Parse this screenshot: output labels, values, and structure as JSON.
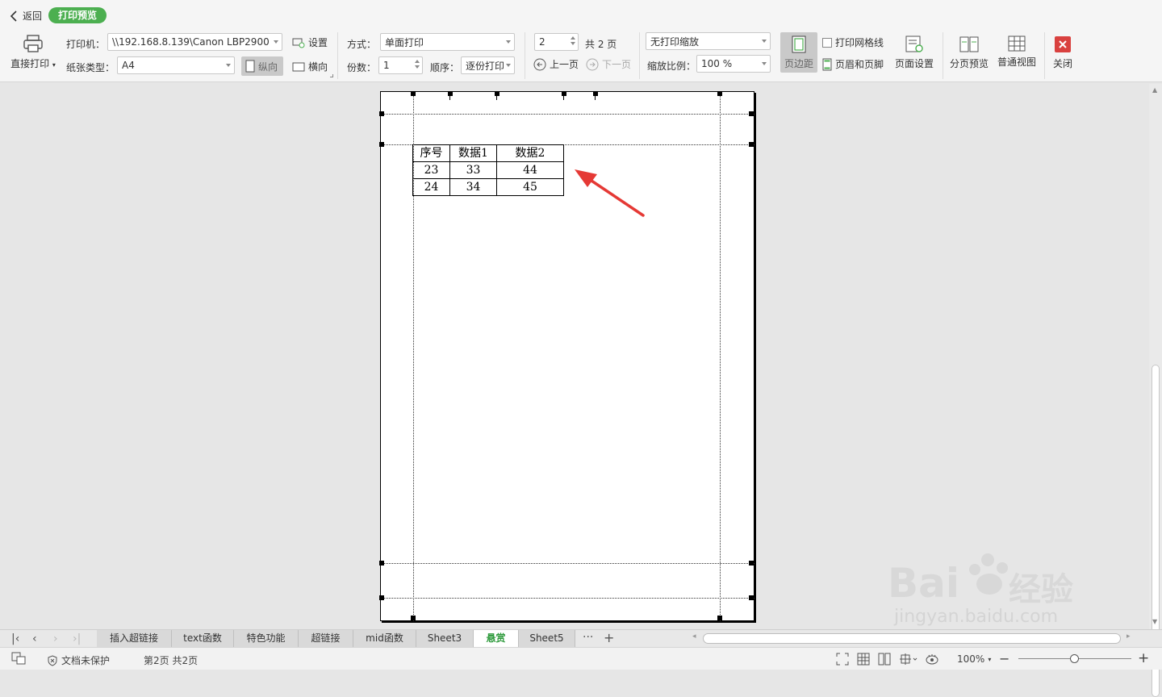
{
  "header": {
    "back_label": "返回",
    "mode_badge": "打印预览"
  },
  "print": {
    "direct_print_label": "直接打印",
    "printer_label": "打印机：",
    "printer_value": "\\\\192.168.8.139\\Canon LBP2900",
    "paper_label": "纸张类型：",
    "paper_value": "A4",
    "settings_label": "设置",
    "portrait_label": "纵向",
    "landscape_label": "横向",
    "method_label": "方式：",
    "method_value": "单面打印",
    "copies_label": "份数：",
    "copies_value": "1",
    "order_label": "顺序：",
    "order_value": "逐份打印",
    "page_value": "2",
    "page_total": "共 2 页",
    "prev_label": "上一页",
    "next_label": "下一页",
    "scale_mode_value": "无打印缩放",
    "scale_ratio_label": "缩放比例：",
    "scale_ratio_value": "100 %",
    "margins_label": "页边距",
    "gridlines_label": "打印网格线",
    "header_footer_label": "页眉和页脚",
    "page_setup_label": "页面设置",
    "page_break_label": "分页预览",
    "normal_view_label": "普通视图",
    "close_label": "关闭"
  },
  "sheet": {
    "headers": [
      "序号",
      "数据1",
      "数据2"
    ],
    "rows": [
      [
        "23",
        "33",
        "44"
      ],
      [
        "24",
        "34",
        "45"
      ]
    ]
  },
  "tabs": [
    {
      "label": "插入超链接"
    },
    {
      "label": "text函数"
    },
    {
      "label": "特色功能"
    },
    {
      "label": "超链接"
    },
    {
      "label": "mid函数"
    },
    {
      "label": "Sheet3"
    },
    {
      "label": "悬赏",
      "active": true
    },
    {
      "label": "Sheet5"
    }
  ],
  "tabs_more": "···",
  "tabs_add": "+",
  "status": {
    "protect_label": "文档未保护",
    "page_info": "第2页 共2页",
    "zoom_value": "100%"
  },
  "watermark": {
    "brand": "Bai  经验",
    "url": "jingyan.baidu.com"
  },
  "colors": {
    "badge": "#4caf50",
    "active_tab_text": "#2e9a3c",
    "close_button": "#d9413f",
    "arrow": "#e53935"
  }
}
